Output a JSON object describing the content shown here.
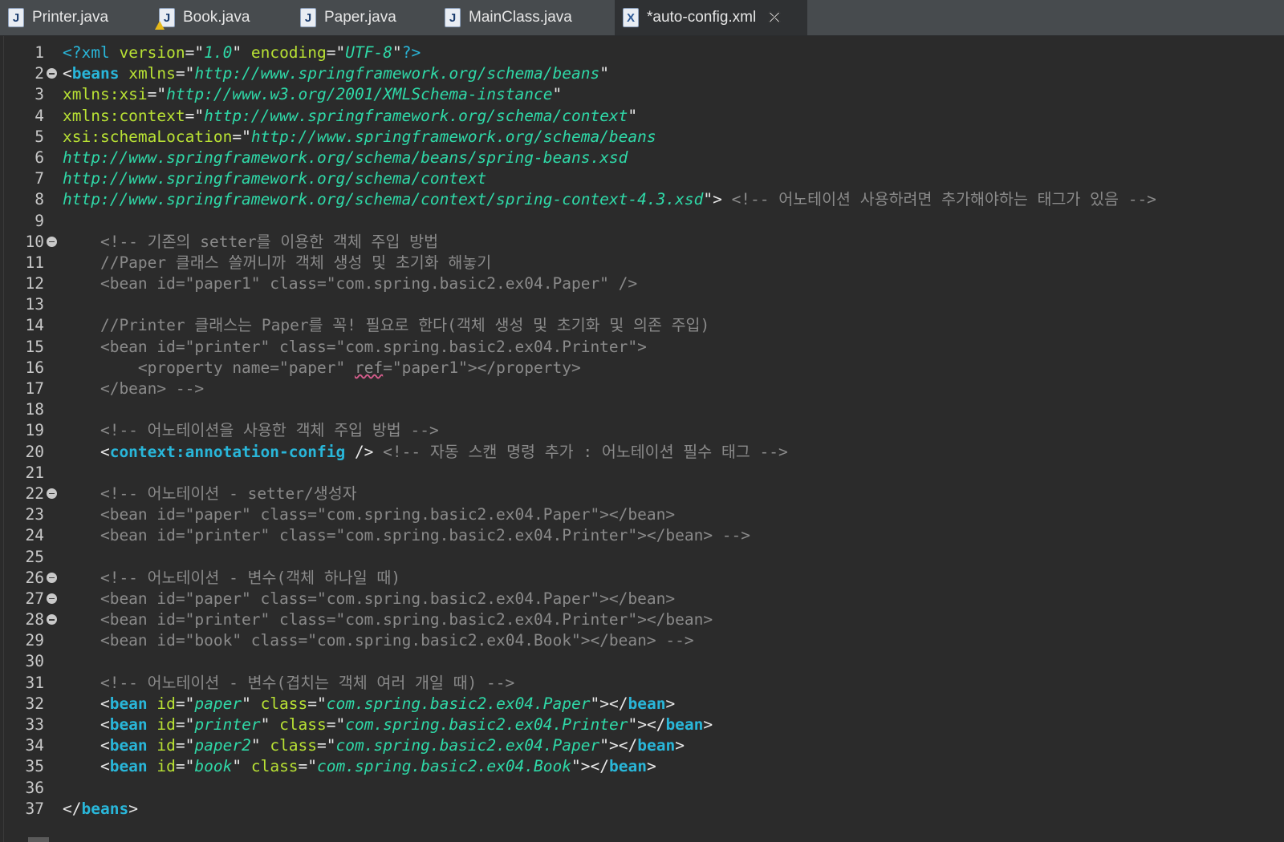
{
  "tabs": [
    {
      "label": "Printer.java",
      "icon": "java-file-icon",
      "icon_letter": "J"
    },
    {
      "label": "Book.java",
      "icon": "java-file-warning-icon",
      "icon_letter": "J"
    },
    {
      "label": "Paper.java",
      "icon": "java-file-icon",
      "icon_letter": "J"
    },
    {
      "label": "MainClass.java",
      "icon": "java-file-icon",
      "icon_letter": "J"
    },
    {
      "label": "*auto-config.xml",
      "icon": "xml-file-icon",
      "icon_letter": "X",
      "active": true
    }
  ],
  "colors": {
    "background": "#2b2b2b",
    "tag": "#29b6d9",
    "attribute": "#b9e234",
    "value": "#2fd9a8",
    "comment": "#8a8a8a"
  },
  "editor": {
    "lines": [
      {
        "n": "1",
        "fold": false,
        "tokens": [
          {
            "c": "pi",
            "t": "<?xml "
          },
          {
            "c": "attr",
            "t": "version"
          },
          {
            "c": "q",
            "t": "=\""
          },
          {
            "c": "val",
            "t": "1.0"
          },
          {
            "c": "q",
            "t": "\" "
          },
          {
            "c": "attr",
            "t": "encoding"
          },
          {
            "c": "q",
            "t": "=\""
          },
          {
            "c": "val",
            "t": "UTF-8"
          },
          {
            "c": "q",
            "t": "\""
          },
          {
            "c": "pi",
            "t": "?>"
          }
        ]
      },
      {
        "n": "2",
        "fold": true,
        "tokens": [
          {
            "c": "br",
            "t": "<"
          },
          {
            "c": "tag",
            "t": "beans"
          },
          {
            "c": "br",
            "t": " "
          },
          {
            "c": "attr",
            "t": "xmlns"
          },
          {
            "c": "q",
            "t": "=\""
          },
          {
            "c": "val",
            "t": "http://www.springframework.org/schema/beans"
          },
          {
            "c": "q",
            "t": "\""
          }
        ]
      },
      {
        "n": "3",
        "fold": false,
        "tokens": [
          {
            "c": "attr",
            "t": "xmlns:xsi"
          },
          {
            "c": "q",
            "t": "=\""
          },
          {
            "c": "val",
            "t": "http://www.w3.org/2001/XMLSchema-instance"
          },
          {
            "c": "q",
            "t": "\""
          }
        ]
      },
      {
        "n": "4",
        "fold": false,
        "tokens": [
          {
            "c": "attr",
            "t": "xmlns:context"
          },
          {
            "c": "q",
            "t": "=\""
          },
          {
            "c": "val",
            "t": "http://www.springframework.org/schema/context"
          },
          {
            "c": "q",
            "t": "\""
          }
        ]
      },
      {
        "n": "5",
        "fold": false,
        "tokens": [
          {
            "c": "attr",
            "t": "xsi:schemaLocation"
          },
          {
            "c": "q",
            "t": "=\""
          },
          {
            "c": "val",
            "t": "http://www.springframework.org/schema/beans"
          }
        ]
      },
      {
        "n": "6",
        "fold": false,
        "tokens": [
          {
            "c": "val",
            "t": "http://www.springframework.org/schema/beans/spring-beans.xsd"
          }
        ]
      },
      {
        "n": "7",
        "fold": false,
        "tokens": [
          {
            "c": "val",
            "t": "http://www.springframework.org/schema/context"
          }
        ]
      },
      {
        "n": "8",
        "fold": false,
        "tokens": [
          {
            "c": "val",
            "t": "http://www.springframework.org/schema/context/spring-context-4.3.xsd"
          },
          {
            "c": "q",
            "t": "\""
          },
          {
            "c": "br",
            "t": "> "
          },
          {
            "c": "cm",
            "t": "<!-- 어노테이션 사용하려면 추가해야하는 태그가 있음 -->"
          }
        ]
      },
      {
        "n": "9",
        "fold": false,
        "tokens": []
      },
      {
        "n": "10",
        "fold": true,
        "tokens": [
          {
            "c": "cm",
            "t": "    <!-- 기존의 setter를 이용한 객체 주입 방법"
          }
        ]
      },
      {
        "n": "11",
        "fold": false,
        "tokens": [
          {
            "c": "cm",
            "t": "    //Paper 클래스 쓸꺼니까 객체 생성 및 초기화 해놓기"
          }
        ]
      },
      {
        "n": "12",
        "fold": false,
        "tokens": [
          {
            "c": "cm",
            "t": "    <bean id=\"paper1\" class=\"com.spring.basic2.ex04.Paper\" />"
          }
        ]
      },
      {
        "n": "13",
        "fold": false,
        "tokens": []
      },
      {
        "n": "14",
        "fold": false,
        "tokens": [
          {
            "c": "cm",
            "t": "    //Printer 클래스는 Paper를 꼭! 필요로 한다(객체 생성 및 초기화 및 의존 주입)"
          }
        ]
      },
      {
        "n": "15",
        "fold": false,
        "tokens": [
          {
            "c": "cm",
            "t": "    <bean id=\"printer\" class=\"com.spring.basic2.ex04.Printer\">"
          }
        ]
      },
      {
        "n": "16",
        "fold": false,
        "tokens": [
          {
            "c": "cm",
            "t": "        <property name=\"paper\" "
          },
          {
            "c": "cmsq",
            "t": "ref"
          },
          {
            "c": "cm",
            "t": "=\"paper1\"></property>"
          }
        ]
      },
      {
        "n": "17",
        "fold": false,
        "tokens": [
          {
            "c": "cm",
            "t": "    </bean> -->"
          }
        ]
      },
      {
        "n": "18",
        "fold": false,
        "tokens": []
      },
      {
        "n": "19",
        "fold": false,
        "tokens": [
          {
            "c": "cm",
            "t": "    <!-- 어노테이션을 사용한 객체 주입 방법 -->"
          }
        ]
      },
      {
        "n": "20",
        "fold": false,
        "tokens": [
          {
            "c": "br",
            "t": "    <"
          },
          {
            "c": "tag",
            "t": "context:annotation-config"
          },
          {
            "c": "br",
            "t": " /> "
          },
          {
            "c": "cm",
            "t": "<!-- 자동 스캔 명령 추가 : 어노테이션 필수 태그 -->"
          }
        ]
      },
      {
        "n": "21",
        "fold": false,
        "tokens": []
      },
      {
        "n": "22",
        "fold": true,
        "tokens": [
          {
            "c": "cm",
            "t": "    <!-- 어노테이션 - setter/생성자"
          }
        ]
      },
      {
        "n": "23",
        "fold": false,
        "tokens": [
          {
            "c": "cm",
            "t": "    <bean id=\"paper\" class=\"com.spring.basic2.ex04.Paper\"></bean>"
          }
        ]
      },
      {
        "n": "24",
        "fold": false,
        "tokens": [
          {
            "c": "cm",
            "t": "    <bean id=\"printer\" class=\"com.spring.basic2.ex04.Printer\"></bean> -->"
          }
        ]
      },
      {
        "n": "25",
        "fold": false,
        "tokens": []
      },
      {
        "n": "26",
        "fold": true,
        "tokens": [
          {
            "c": "cm",
            "t": "    <!-- 어노테이션 - 변수(객체 하나일 때)"
          }
        ]
      },
      {
        "n": "27",
        "fold": true,
        "tokens": [
          {
            "c": "cm",
            "t": "    <bean id=\"paper\" class=\"com.spring.basic2.ex04.Paper\"></bean>"
          }
        ]
      },
      {
        "n": "28",
        "fold": true,
        "tokens": [
          {
            "c": "cm",
            "t": "    <bean id=\"printer\" class=\"com.spring.basic2.ex04.Printer\"></bean>"
          }
        ]
      },
      {
        "n": "29",
        "fold": false,
        "tokens": [
          {
            "c": "cm",
            "t": "    <bean id=\"book\" class=\"com.spring.basic2.ex04.Book\"></bean> -->"
          }
        ]
      },
      {
        "n": "30",
        "fold": false,
        "tokens": []
      },
      {
        "n": "31",
        "fold": false,
        "tokens": [
          {
            "c": "cm",
            "t": "    <!-- 어노테이션 - 변수(겹치는 객체 여러 개일 때) -->"
          }
        ]
      },
      {
        "n": "32",
        "fold": false,
        "tokens": [
          {
            "c": "br",
            "t": "    <"
          },
          {
            "c": "tag",
            "t": "bean"
          },
          {
            "c": "br",
            "t": " "
          },
          {
            "c": "attr",
            "t": "id"
          },
          {
            "c": "q",
            "t": "=\""
          },
          {
            "c": "val",
            "t": "paper"
          },
          {
            "c": "q",
            "t": "\" "
          },
          {
            "c": "attr",
            "t": "class"
          },
          {
            "c": "q",
            "t": "=\""
          },
          {
            "c": "val",
            "t": "com.spring.basic2.ex04.Paper"
          },
          {
            "c": "q",
            "t": "\""
          },
          {
            "c": "br",
            "t": "></"
          },
          {
            "c": "tag",
            "t": "bean"
          },
          {
            "c": "br",
            "t": ">"
          }
        ]
      },
      {
        "n": "33",
        "fold": false,
        "tokens": [
          {
            "c": "br",
            "t": "    <"
          },
          {
            "c": "tag",
            "t": "bean"
          },
          {
            "c": "br",
            "t": " "
          },
          {
            "c": "attr",
            "t": "id"
          },
          {
            "c": "q",
            "t": "=\""
          },
          {
            "c": "val",
            "t": "printer"
          },
          {
            "c": "q",
            "t": "\" "
          },
          {
            "c": "attr",
            "t": "class"
          },
          {
            "c": "q",
            "t": "=\""
          },
          {
            "c": "val",
            "t": "com.spring.basic2.ex04.Printer"
          },
          {
            "c": "q",
            "t": "\""
          },
          {
            "c": "br",
            "t": "></"
          },
          {
            "c": "tag",
            "t": "bean"
          },
          {
            "c": "br",
            "t": ">"
          }
        ]
      },
      {
        "n": "34",
        "fold": false,
        "tokens": [
          {
            "c": "br",
            "t": "    <"
          },
          {
            "c": "tag",
            "t": "bean"
          },
          {
            "c": "br",
            "t": " "
          },
          {
            "c": "attr",
            "t": "id"
          },
          {
            "c": "q",
            "t": "=\""
          },
          {
            "c": "val",
            "t": "paper2"
          },
          {
            "c": "q",
            "t": "\" "
          },
          {
            "c": "attr",
            "t": "class"
          },
          {
            "c": "q",
            "t": "=\""
          },
          {
            "c": "val",
            "t": "com.spring.basic2.ex04.Paper"
          },
          {
            "c": "q",
            "t": "\""
          },
          {
            "c": "br",
            "t": "></"
          },
          {
            "c": "tag",
            "t": "bean"
          },
          {
            "c": "br",
            "t": ">"
          }
        ]
      },
      {
        "n": "35",
        "fold": false,
        "tokens": [
          {
            "c": "br",
            "t": "    <"
          },
          {
            "c": "tag",
            "t": "bean"
          },
          {
            "c": "br",
            "t": " "
          },
          {
            "c": "attr",
            "t": "id"
          },
          {
            "c": "q",
            "t": "=\""
          },
          {
            "c": "val",
            "t": "book"
          },
          {
            "c": "q",
            "t": "\" "
          },
          {
            "c": "attr",
            "t": "class"
          },
          {
            "c": "q",
            "t": "=\""
          },
          {
            "c": "val",
            "t": "com.spring.basic2.ex04.Book"
          },
          {
            "c": "q",
            "t": "\""
          },
          {
            "c": "br",
            "t": "></"
          },
          {
            "c": "tag",
            "t": "bean"
          },
          {
            "c": "br",
            "t": ">"
          }
        ]
      },
      {
        "n": "36",
        "fold": false,
        "tokens": []
      },
      {
        "n": "37",
        "fold": false,
        "tokens": [
          {
            "c": "br",
            "t": "</"
          },
          {
            "c": "tag",
            "t": "beans"
          },
          {
            "c": "br",
            "t": ">"
          }
        ]
      }
    ]
  }
}
